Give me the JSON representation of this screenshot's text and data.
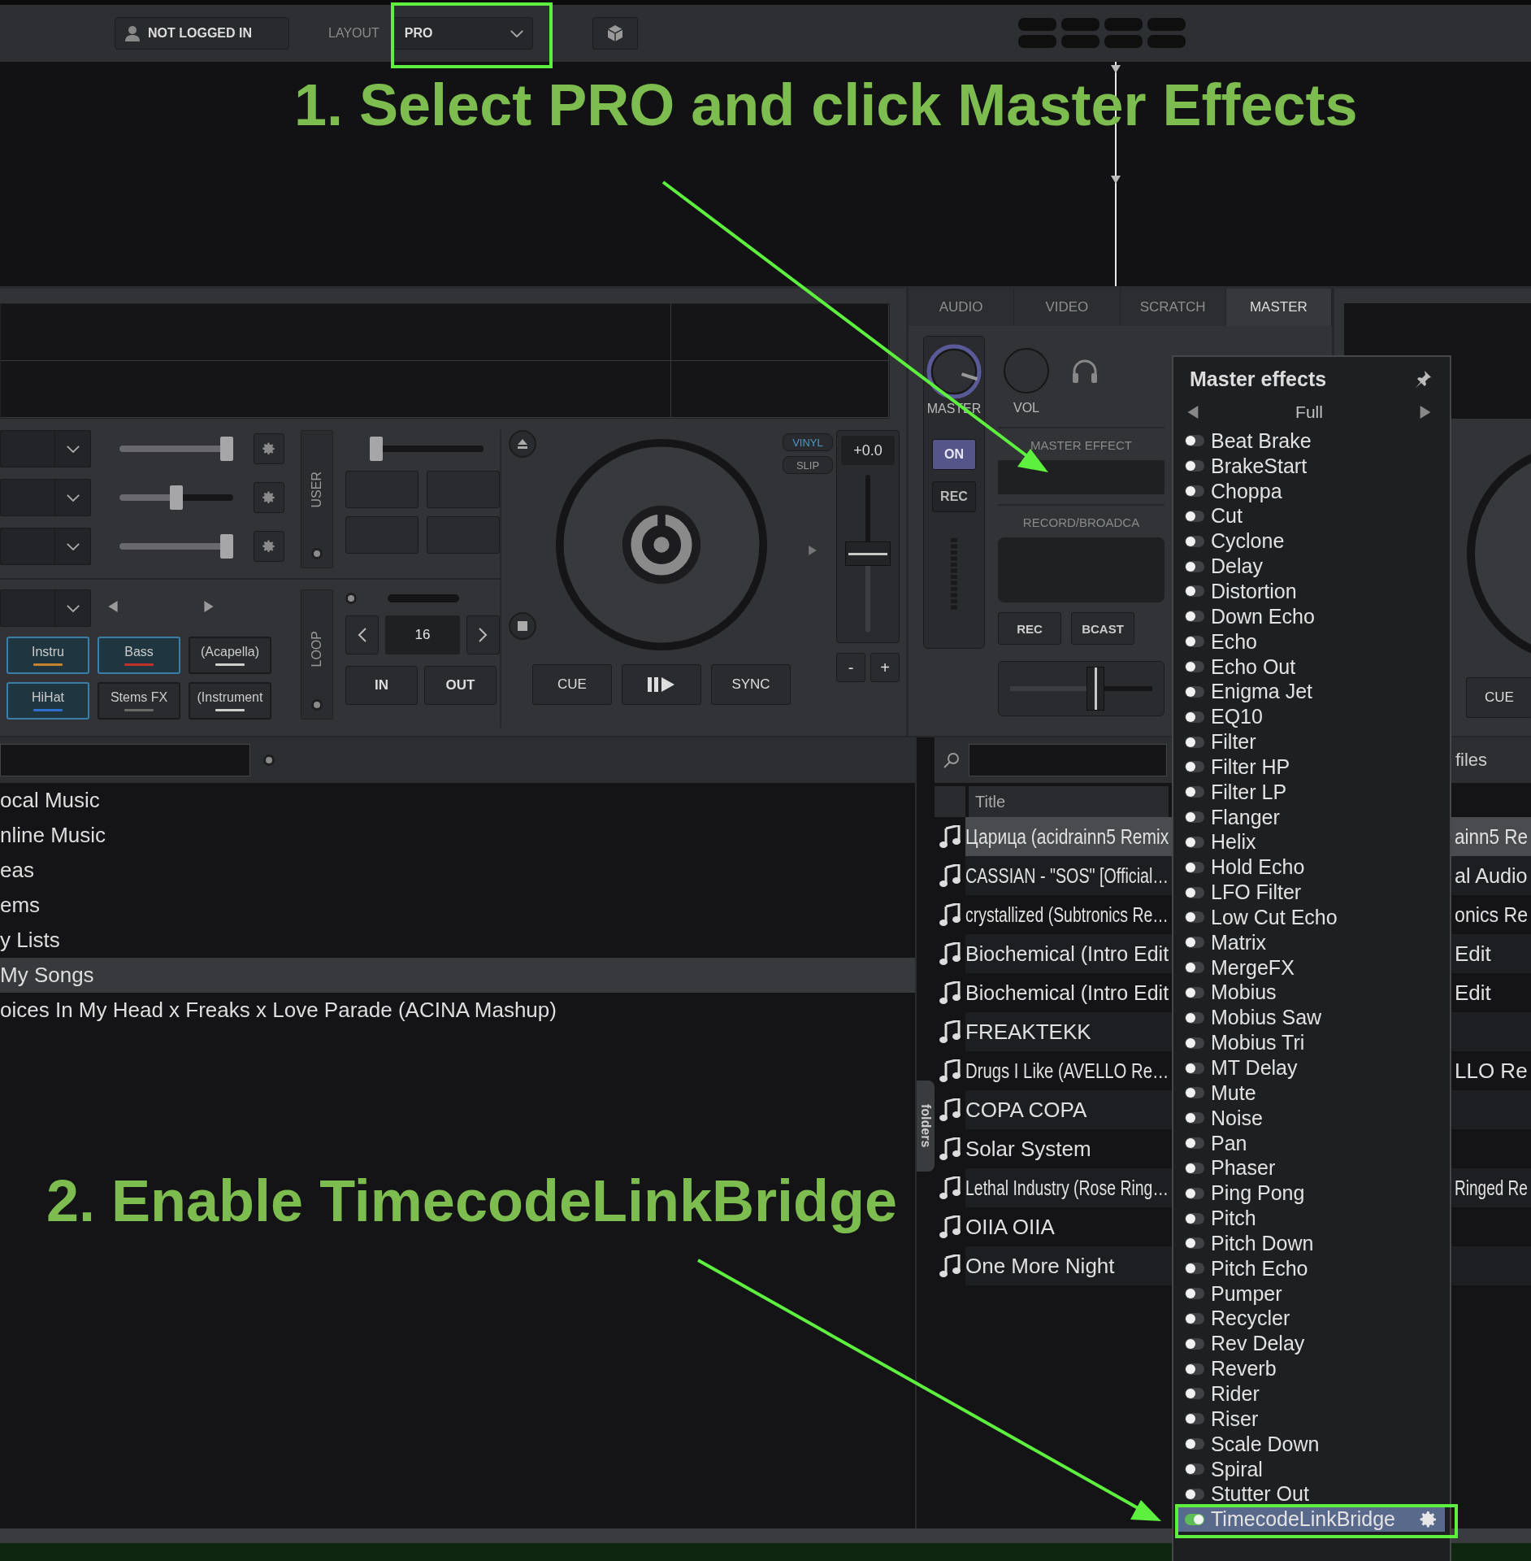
{
  "top_bar": {
    "account": "NOT LOGGED IN",
    "layout_label": "LAYOUT",
    "layout_value": "PRO"
  },
  "annotations": [
    {
      "text": "1. Select PRO and click Master Effects"
    },
    {
      "text": "2. Enable TimecodeLinkBridge"
    }
  ],
  "left_deck": {
    "fx_sliders": [
      {
        "level": 1
      },
      {
        "level": 0.5
      },
      {
        "level": 1
      }
    ],
    "user_label": "USER",
    "pad_slider": {
      "level": 0
    },
    "loop_label": "LOOP",
    "stems": [
      {
        "label": "Instru",
        "selected": true,
        "color": "#c8822a"
      },
      {
        "label": "Bass",
        "selected": true,
        "color": "#c0302a"
      },
      {
        "label": "(Acapella)",
        "selected": false,
        "color": "#cfcfcf"
      },
      {
        "label": "HiHat",
        "selected": true,
        "color": "#2f6fd0"
      },
      {
        "label": "Stems FX",
        "selected": false,
        "color": "#6a6a6a"
      },
      {
        "label": "(Instrument",
        "selected": false,
        "color": "#cfcfcf"
      }
    ],
    "loop_size": "16",
    "loop_in": "IN",
    "loop_out": "OUT",
    "modes": [
      {
        "label": "VINYL",
        "selected": true
      },
      {
        "label": "SLIP",
        "selected": false
      }
    ],
    "pitch_reading": "+0.0",
    "pitch": {
      "level": 0.5
    },
    "pitch_minus": "-",
    "pitch_plus": "+",
    "transport": [
      {
        "kind": "text",
        "label": "CUE"
      },
      {
        "kind": "play"
      },
      {
        "kind": "text",
        "label": "SYNC"
      }
    ]
  },
  "mixer": {
    "tabs": [
      {
        "label": "AUDIO",
        "selected": false
      },
      {
        "label": "VIDEO",
        "selected": false
      },
      {
        "label": "SCRATCH",
        "selected": false
      },
      {
        "label": "MASTER",
        "selected": true
      }
    ],
    "master_knob": {
      "label": "MASTER",
      "level": 0.9
    },
    "vol_knob": {
      "label": "VOL"
    },
    "strip_buttons": [
      {
        "label": "ON",
        "selected": true
      },
      {
        "label": "REC",
        "selected": false
      }
    ],
    "master_effect_label": "MASTER EFFECT",
    "record_label": "RECORD/BROADCA",
    "record_buttons": [
      "REC",
      "BCAST"
    ],
    "crossfader": {
      "level": 0.6
    }
  },
  "right_deck": {
    "cue": "CUE"
  },
  "browser": {
    "folders": [
      {
        "label": "ocal Music",
        "selected": false
      },
      {
        "label": "nline Music",
        "selected": false
      },
      {
        "label": "eas",
        "selected": false
      },
      {
        "label": "ems",
        "selected": false
      },
      {
        "label": "y Lists",
        "selected": false
      },
      {
        "label": "My Songs",
        "selected": true
      },
      {
        "label": "oices In My Head x Freaks x Love Parade (ACINA Mashup)",
        "selected": false
      }
    ],
    "folders_tab": "folders",
    "side_tab": "files",
    "columns": [
      "Title"
    ],
    "tracks": [
      {
        "title": "Царица (acidrainn5 Remix",
        "column_2": "ainn5 Re",
        "selected": true
      },
      {
        "title": "CASSIAN - \"SOS\" [Official…",
        "column_2": "al Audio",
        "selected": false
      },
      {
        "title": "crystallized (Subtronics Re…",
        "column_2": "onics Re",
        "selected": false
      },
      {
        "title": "Biochemical (Intro Edit",
        "column_2": "Edit",
        "selected": false
      },
      {
        "title": "Biochemical (Intro Edit",
        "column_2": "Edit",
        "selected": false
      },
      {
        "title": "FREAKTEKK",
        "selected": false
      },
      {
        "title": "Drugs I Like (AVELLO Re…",
        "column_2": "LLO Re",
        "selected": false
      },
      {
        "title": "COPA COPA",
        "selected": false
      },
      {
        "title": "Solar System",
        "selected": false
      },
      {
        "title": "Lethal Industry (Rose Ring…",
        "column_2": "Ringed Re",
        "selected": false
      },
      {
        "title": "OIIA OIIA",
        "selected": false
      },
      {
        "title": "One More Night",
        "selected": false
      }
    ]
  },
  "master_effects": {
    "title": "Master effects",
    "view": "Full",
    "effects": [
      {
        "name": "Beat Brake",
        "on": false,
        "selected": false
      },
      {
        "name": "BrakeStart",
        "on": false,
        "selected": false
      },
      {
        "name": "Choppa",
        "on": false,
        "selected": false
      },
      {
        "name": "Cut",
        "on": false,
        "selected": false
      },
      {
        "name": "Cyclone",
        "on": false,
        "selected": false
      },
      {
        "name": "Delay",
        "on": false,
        "selected": false
      },
      {
        "name": "Distortion",
        "on": false,
        "selected": false
      },
      {
        "name": "Down Echo",
        "on": false,
        "selected": false
      },
      {
        "name": "Echo",
        "on": false,
        "selected": false
      },
      {
        "name": "Echo Out",
        "on": false,
        "selected": false
      },
      {
        "name": "Enigma Jet",
        "on": false,
        "selected": false
      },
      {
        "name": "EQ10",
        "on": false,
        "selected": false
      },
      {
        "name": "Filter",
        "on": false,
        "selected": false
      },
      {
        "name": "Filter HP",
        "on": false,
        "selected": false
      },
      {
        "name": "Filter LP",
        "on": false,
        "selected": false
      },
      {
        "name": "Flanger",
        "on": false,
        "selected": false
      },
      {
        "name": "Helix",
        "on": false,
        "selected": false
      },
      {
        "name": "Hold Echo",
        "on": false,
        "selected": false
      },
      {
        "name": "LFO Filter",
        "on": false,
        "selected": false
      },
      {
        "name": "Low Cut Echo",
        "on": false,
        "selected": false
      },
      {
        "name": "Matrix",
        "on": false,
        "selected": false
      },
      {
        "name": "MergeFX",
        "on": false,
        "selected": false
      },
      {
        "name": "Mobius",
        "on": false,
        "selected": false
      },
      {
        "name": "Mobius Saw",
        "on": false,
        "selected": false
      },
      {
        "name": "Mobius Tri",
        "on": false,
        "selected": false
      },
      {
        "name": "MT Delay",
        "on": false,
        "selected": false
      },
      {
        "name": "Mute",
        "on": false,
        "selected": false
      },
      {
        "name": "Noise",
        "on": false,
        "selected": false
      },
      {
        "name": "Pan",
        "on": false,
        "selected": false
      },
      {
        "name": "Phaser",
        "on": false,
        "selected": false
      },
      {
        "name": "Ping Pong",
        "on": false,
        "selected": false
      },
      {
        "name": "Pitch",
        "on": false,
        "selected": false
      },
      {
        "name": "Pitch Down",
        "on": false,
        "selected": false
      },
      {
        "name": "Pitch Echo",
        "on": false,
        "selected": false
      },
      {
        "name": "Pumper",
        "on": false,
        "selected": false
      },
      {
        "name": "Recycler",
        "on": false,
        "selected": false
      },
      {
        "name": "Rev Delay",
        "on": false,
        "selected": false
      },
      {
        "name": "Reverb",
        "on": false,
        "selected": false
      },
      {
        "name": "Rider",
        "on": false,
        "selected": false
      },
      {
        "name": "Riser",
        "on": false,
        "selected": false
      },
      {
        "name": "Scale Down",
        "on": false,
        "selected": false
      },
      {
        "name": "Spiral",
        "on": false,
        "selected": false
      },
      {
        "name": "Stutter Out",
        "on": false,
        "selected": false
      },
      {
        "name": "TimecodeLinkBridge",
        "on": true,
        "selected": true
      }
    ]
  }
}
